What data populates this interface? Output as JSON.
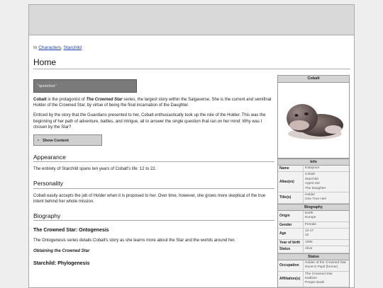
{
  "breadcrumb": {
    "prefix": "In",
    "categories": [
      "Characters",
      "Starchild"
    ],
    "separator": ","
  },
  "title": "Home",
  "quotebox": "\"quotebox\"",
  "intro": {
    "name": "Cobalt",
    "text_a": " is the protagonist of ",
    "series": "The Crowned Star",
    "text_b": " series, the largest story within the Salgaverse. She is the current and semifinal Holder of the Crowned Star, by virtue of being the final incarnation of the Daughter."
  },
  "intro2": "Enticed by the story that the Guardians presented to her, Cobalt enthusiastically took up the role of the Holder. This was the beginning of her path of adventure, battles, and intrigue, all to answer the single question that ran on her mind: Why was I chosen by the Star?",
  "show_content": "Show Content",
  "sections": {
    "appearance": {
      "heading": "Appearance",
      "text": "The entirety of Starchild spans ten years of Cobalt's life: 12 to 22."
    },
    "personality": {
      "heading": "Personality",
      "text": "Cobalt easily accepts the job of Holder when it is proposed to her. Over time, however, she grows more skeptical of the true intent behind her whole mission."
    },
    "biography": {
      "heading": "Biography",
      "sub1": "The Crowned Star: Ontogenesis",
      "sub1_text": "The Ontogenesis series details Cobalt's story as she learns more about the Star and the worlds around her.",
      "sub1_link": "Obtaining the Crowned Star",
      "sub2": "Starchild: Phylogenesis"
    }
  },
  "infobox": {
    "name": "Cobalt",
    "info_header": "Info",
    "info_rows": [
      {
        "label": "Name",
        "values": [
          "Katayoun"
        ]
      },
      {
        "label": "Alias(es)",
        "values": [
          "Cobalt",
          "Starchild",
          "Agent Zar",
          "The Daughter"
        ]
      },
      {
        "label": "Title(s)",
        "values": [
          "Holder",
          "One True Heir"
        ]
      }
    ],
    "bio_header": "Biography",
    "bio_rows": [
      {
        "label": "Origin",
        "values": [
          "Earth",
          "Europe"
        ]
      },
      {
        "label": "Gender",
        "values": [
          "Female"
        ]
      },
      {
        "label": "Age",
        "values": [
          "12-17",
          "22"
        ]
      },
      {
        "label": "Year of birth",
        "values": [
          "1996"
        ]
      },
      {
        "label": "Status",
        "values": [
          "Alive"
        ]
      }
    ],
    "status_header": "Status",
    "status_rows": [
      {
        "label": "Occupation",
        "values": [
          "Holder of the Crowned Star",
          "Doom's Pupil (former)"
        ]
      },
      {
        "label": "Affiliation(s)",
        "values": [
          "The Crowned Star",
          "tradition",
          "Poopie Buds"
        ]
      }
    ]
  },
  "colors": {
    "link": "#1a3fb0",
    "quotebox_bg": "#7a7a7a",
    "infobox_header": "#d3d3d3"
  }
}
